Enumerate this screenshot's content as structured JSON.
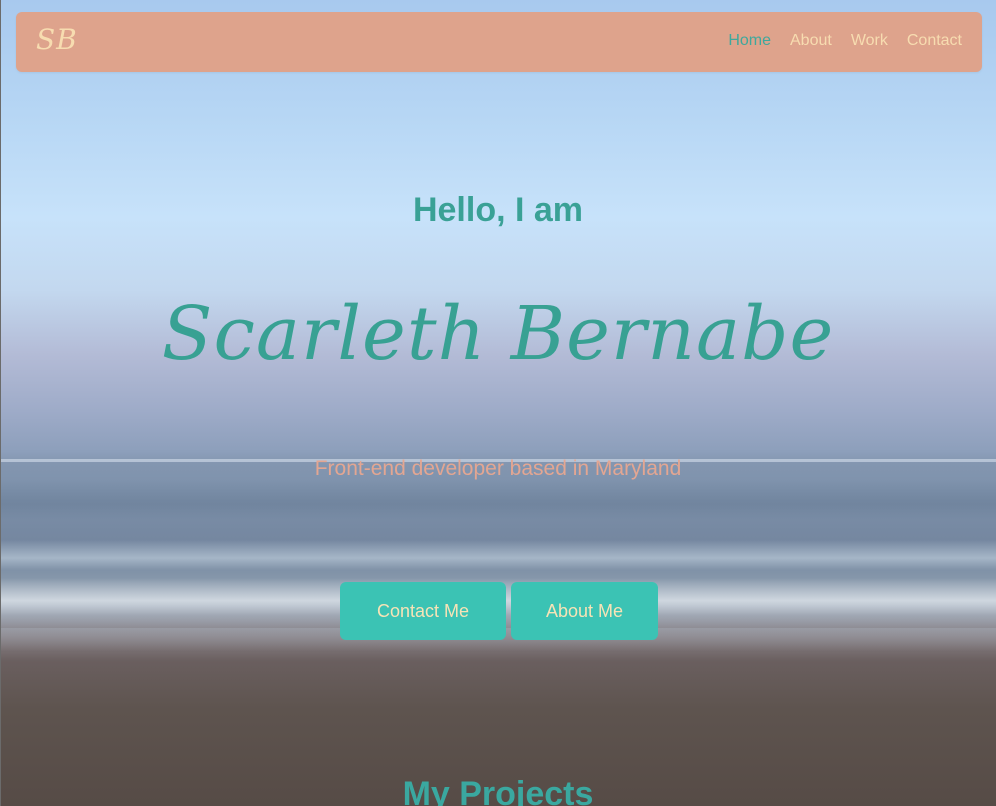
{
  "navbar": {
    "brand": "SB",
    "links": [
      {
        "label": "Home",
        "active": true
      },
      {
        "label": "About",
        "active": false
      },
      {
        "label": "Work",
        "active": false
      },
      {
        "label": "Contact",
        "active": false
      }
    ]
  },
  "hero": {
    "greeting": "Hello, I am",
    "name": "Scarleth Bernabe",
    "tagline": "Front-end developer based in Maryland",
    "buttons": {
      "contact_label": "Contact Me",
      "about_label": "About Me"
    }
  },
  "projects": {
    "title": "My Projects"
  },
  "colors": {
    "navbar_bg": "#dea38c",
    "accent_teal": "#3aa196",
    "button_bg": "#3bc3b4",
    "cream": "#f7dcb0",
    "tagline": "#e3a692"
  }
}
